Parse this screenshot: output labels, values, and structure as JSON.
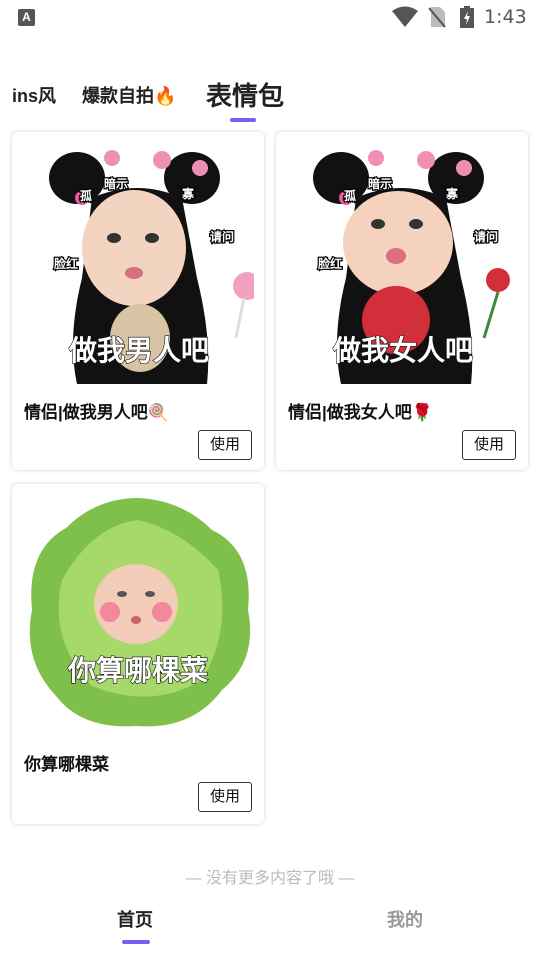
{
  "status_bar": {
    "time": "1:43",
    "app_letter": "A"
  },
  "tabs": [
    {
      "label": "ins风"
    },
    {
      "label": "爆款自拍🔥"
    },
    {
      "label": "表情包",
      "active": true
    }
  ],
  "cards": [
    {
      "title": "情侣|做我男人吧🍭",
      "caption": "做我男人吧",
      "tags": [
        "暗示",
        "孤",
        "寡",
        "请问",
        "脸红"
      ],
      "button": "使用"
    },
    {
      "title": "情侣|做我女人吧🌹",
      "caption": "做我女人吧",
      "tags": [
        "暗示",
        "孤",
        "寡",
        "请问",
        "脸红"
      ],
      "button": "使用"
    },
    {
      "title": "你算哪棵菜",
      "caption": "你算哪棵菜",
      "button": "使用"
    }
  ],
  "footer_note": "— 没有更多内容了哦 —",
  "bottom_nav": [
    {
      "label": "首页",
      "active": true
    },
    {
      "label": "我的"
    }
  ],
  "colors": {
    "accent": "#7c5cf0"
  }
}
